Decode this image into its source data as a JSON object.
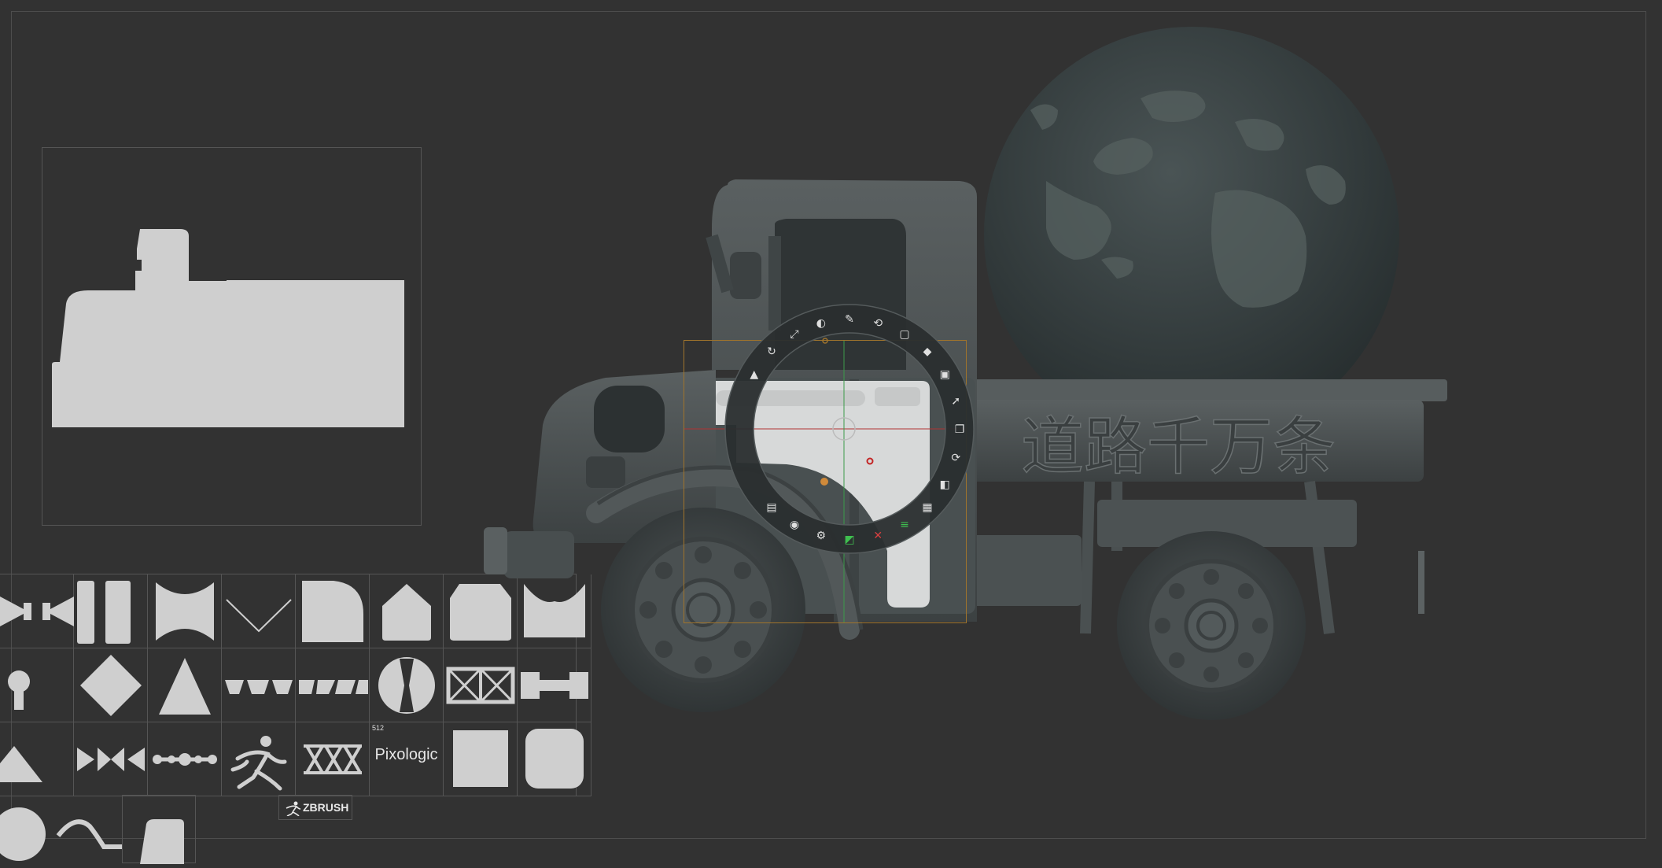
{
  "app": {
    "name": "ZBrush",
    "logo_text": "ZBRUSH"
  },
  "palette": {
    "thumb_size_label": "512",
    "pixologic_label": "Pixologic",
    "cells": [
      {
        "icon": "bowtie-alpha-icon"
      },
      {
        "icon": "double-bar-alpha-icon"
      },
      {
        "icon": "hourglass-alpha-icon"
      },
      {
        "icon": "v-line-alpha-icon"
      },
      {
        "icon": "rounded-corner-alpha-icon"
      },
      {
        "icon": "house-alpha-icon"
      },
      {
        "icon": "chamfer-alpha-icon"
      },
      {
        "icon": "notch-alpha-icon"
      },
      {
        "icon": "keyhole-alpha-icon"
      },
      {
        "icon": "diamond-alpha-icon"
      },
      {
        "icon": "triangle-alpha-icon"
      },
      {
        "icon": "trapezoid-row-alpha-icon"
      },
      {
        "icon": "slant-row-alpha-icon"
      },
      {
        "icon": "hourglass-circle-alpha-icon"
      },
      {
        "icon": "crossed-boxes-alpha-icon"
      },
      {
        "icon": "h-beam-alpha-icon"
      },
      {
        "icon": "half-triangle-alpha-icon"
      },
      {
        "icon": "bowtie-chain-alpha-icon"
      },
      {
        "icon": "dot-chain-alpha-icon"
      },
      {
        "icon": "zbrush-runner-alpha-icon"
      },
      {
        "icon": "lattice-alpha-icon"
      },
      {
        "icon": "pixologic-alpha-icon"
      },
      {
        "icon": "square-alpha-icon"
      },
      {
        "icon": "rounded-square-alpha-icon"
      }
    ],
    "bottom_row": [
      {
        "icon": "half-circle-alpha-icon"
      },
      {
        "icon": "curve-stroke-alpha-icon"
      },
      {
        "icon": "arch-alpha-icon"
      }
    ]
  },
  "scene": {
    "truck_text": "道路千万条",
    "colors": {
      "background": "#323232",
      "model": "#4a4f50",
      "globe": "#374041",
      "gizmo_frame": "#a0742c",
      "palette_fill": "#cfcfcf"
    }
  },
  "gizmo": {
    "icons": [
      "move-tool-icon",
      "rotate-tool-icon",
      "scale-tool-icon",
      "color-picker-icon",
      "brush-icon",
      "reset-icon",
      "frame-icon",
      "paint-bucket-icon",
      "lock-icon",
      "arrow-icon",
      "copy-icon",
      "refresh-icon",
      "split-icon",
      "grid-icon",
      "align-icon",
      "delete-icon",
      "mask-icon",
      "gear-icon",
      "camera-icon",
      "folder-icon"
    ]
  }
}
